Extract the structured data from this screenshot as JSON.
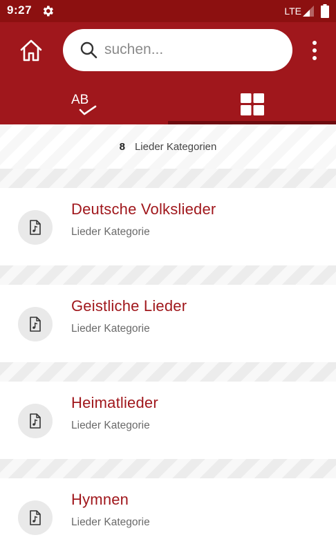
{
  "status_bar": {
    "time": "9:27",
    "network": "LTE",
    "icons": [
      "gear-icon",
      "signal-icon",
      "battery-icon"
    ]
  },
  "header": {
    "home_icon": "home-icon",
    "search": {
      "placeholder": "suchen...",
      "value": ""
    },
    "menu_icon": "more-vert-icon",
    "tabs": [
      {
        "label": "AB",
        "icon": "ab-check-icon",
        "selected": false
      },
      {
        "icon": "grid-icon",
        "selected": true
      }
    ]
  },
  "summary": {
    "count": "8",
    "label": "Lieder Kategorien"
  },
  "categories": [
    {
      "title": "Deutsche Volkslieder",
      "subtitle": "Lieder Kategorie",
      "icon": "music-file-icon"
    },
    {
      "title": "Geistliche Lieder",
      "subtitle": "Lieder Kategorie",
      "icon": "music-file-icon"
    },
    {
      "title": "Heimatlieder",
      "subtitle": "Lieder Kategorie",
      "icon": "music-file-icon"
    },
    {
      "title": "Hymnen",
      "subtitle": "Lieder Kategorie",
      "icon": "music-file-icon"
    }
  ],
  "colors": {
    "primary": "#a0171c",
    "status_bar": "#8c1010",
    "tab_indicator": "#6e0c10"
  }
}
